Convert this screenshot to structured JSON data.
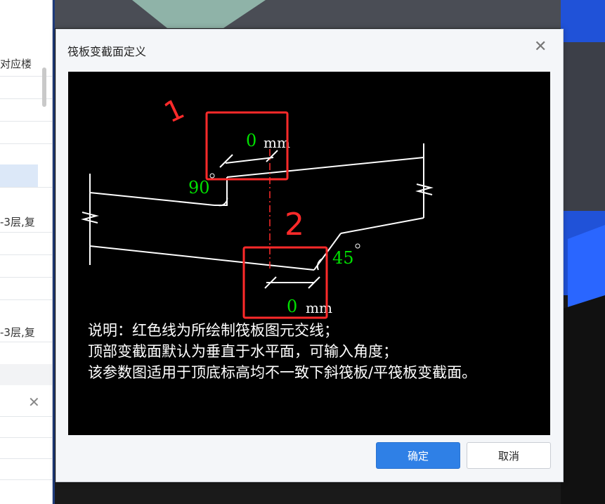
{
  "left_panel": {
    "header_text": "对应楼",
    "row_texts": [
      "-3层,复",
      "-3层,复"
    ]
  },
  "dialog": {
    "title": "筏板变截面定义",
    "close_icon": "close-icon",
    "confirm_label": "确定",
    "cancel_label": "取消"
  },
  "diagram": {
    "top_offset_value": "0",
    "top_offset_unit": "mm",
    "bottom_offset_value": "0",
    "bottom_offset_unit": "mm",
    "top_angle": "90",
    "bottom_angle": "45",
    "note_lines": [
      "说明：红色线为所绘制筏板图元交线；",
      "顶部变截面默认为垂直于水平面，可输入角度；",
      "该参数图适用于顶底标高均不一致下斜筏板/平筏板变截面。"
    ],
    "annotation_1": "1",
    "annotation_2": "2"
  },
  "colors": {
    "accent": "#2f80e6",
    "diagram_green": "#00e000",
    "annotation_red": "#ff2a2a"
  }
}
